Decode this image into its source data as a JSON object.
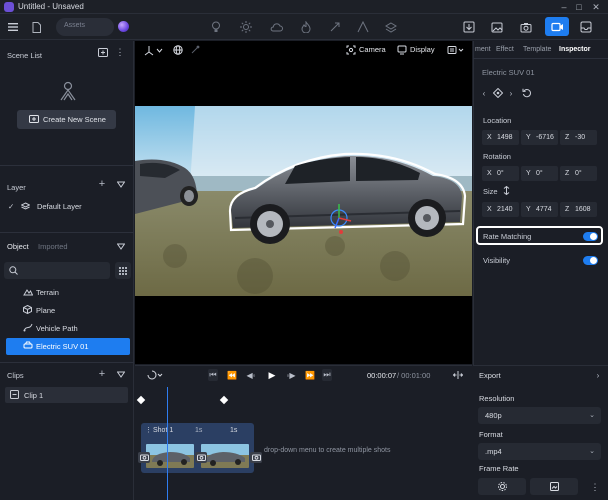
{
  "window": {
    "title": "Untitled - Unsaved"
  },
  "toolbar": {
    "assets_placeholder": "Assets"
  },
  "scene_list": {
    "title": "Scene List",
    "create_button": "Create New Scene"
  },
  "layer": {
    "title": "Layer",
    "items": [
      {
        "label": "Default Layer"
      }
    ]
  },
  "objects": {
    "tabs": [
      "Object",
      "Imported"
    ],
    "items": [
      {
        "label": "Terrain"
      },
      {
        "label": "Plane"
      },
      {
        "label": "Vehicle Path"
      },
      {
        "label": "Electric SUV 01",
        "selected": true
      }
    ]
  },
  "clips": {
    "title": "Clips",
    "items": [
      {
        "label": "Clip 1"
      }
    ]
  },
  "viewport": {
    "camera_label": "Camera",
    "display_label": "Display"
  },
  "right_tabs": {
    "ment": "ment",
    "effect": "Effect",
    "template": "Template",
    "inspector": "Inspector"
  },
  "inspector": {
    "object_name": "Electric SUV 01",
    "location": {
      "label": "Location",
      "x": "1498",
      "y": "-6716",
      "z": "-30"
    },
    "rotation": {
      "label": "Rotation",
      "x": "0°",
      "y": "0°",
      "z": "0°"
    },
    "size": {
      "label": "Size",
      "x": "2140",
      "y": "4774",
      "z": "1608"
    },
    "rate_matching": {
      "label": "Rate Matching",
      "on": true
    },
    "visibility": {
      "label": "Visibility",
      "on": true
    }
  },
  "timeline": {
    "current_time": "00:00:07",
    "total_time": "/ 00:01:00",
    "shot_label": "Shot 1",
    "shot_dur_1": "1s",
    "shot_dur_2": "1s",
    "hint": "drop-down menu to create multiple shots"
  },
  "export": {
    "title": "Export",
    "resolution": {
      "label": "Resolution",
      "value": "480p"
    },
    "format": {
      "label": "Format",
      "value": ".mp4"
    },
    "frame_rate": {
      "label": "Frame Rate"
    }
  },
  "colors": {
    "accent": "#1e7df0",
    "panel": "#1b1e26",
    "field": "#262a33"
  }
}
